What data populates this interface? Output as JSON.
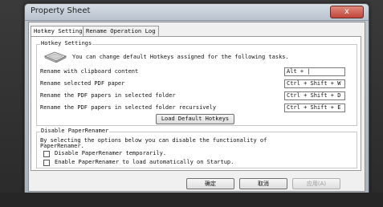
{
  "window": {
    "title": "Property Sheet",
    "close_label": "x"
  },
  "tabs": [
    {
      "label": "Hotkey Setting"
    },
    {
      "label": "Rename Operation Log"
    }
  ],
  "hotkey_group": {
    "label": "Hotkey Settings",
    "description": "You can change default Hotkeys assigned for the following tasks.",
    "rows": [
      {
        "label": "Rename with clipboard content",
        "value": "Alt + |"
      },
      {
        "label": "Rename selected PDF paper",
        "value": "Ctrl + Shift + W"
      },
      {
        "label": "Rename the PDF papers in selected folder",
        "value": "Ctrl + Shift + D"
      },
      {
        "label": "Rename the PDF papers in selected folder recursively",
        "value": "Ctrl + Shift + E"
      }
    ],
    "load_default_label": "Load Default Hotkeys"
  },
  "disable_group": {
    "label": "Disable PaperRenamer",
    "description_line1": "By selecting the options below you can disable the functionality of",
    "description_line2": "PaperRenamer.",
    "options": [
      {
        "label": "Disable PaperRenamer temporarily."
      },
      {
        "label": "Enable PaperRenamer to load automatically on Startup."
      }
    ]
  },
  "buttons": {
    "ok": "确定",
    "cancel": "取消",
    "apply": "应用(A)"
  },
  "icons": {
    "keyboard": "keyboard-icon",
    "close": "close-icon"
  }
}
